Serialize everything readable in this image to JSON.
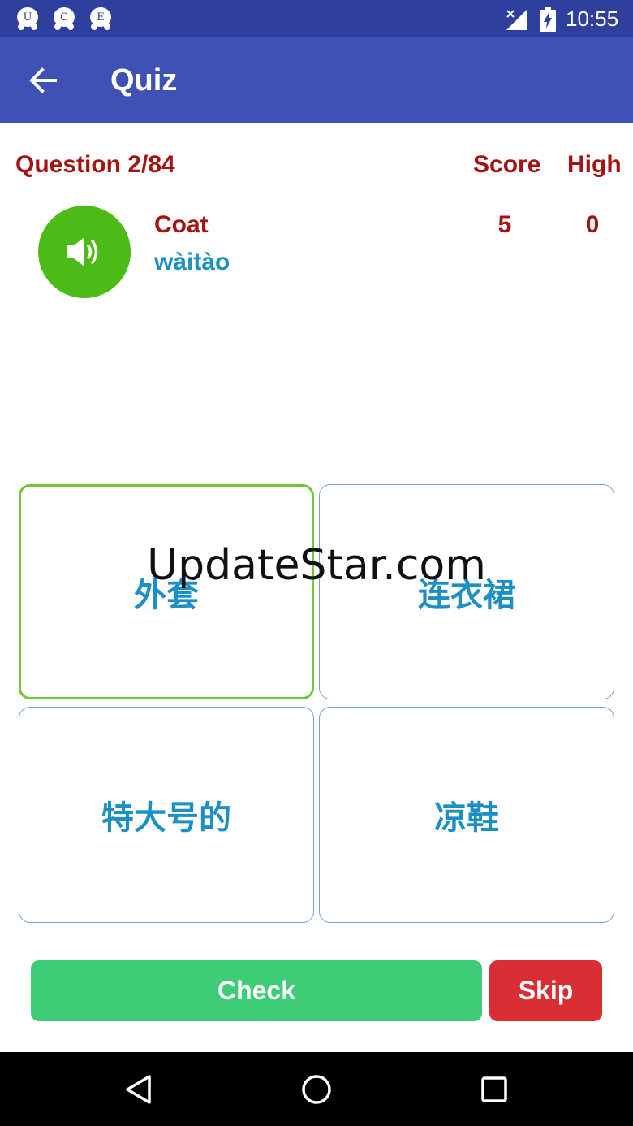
{
  "status_bar": {
    "notifications": [
      "U",
      "C",
      "E"
    ],
    "time": "10:55",
    "icons": [
      "signal-no-data-icon",
      "battery-charging-icon"
    ]
  },
  "app_bar": {
    "title": "Quiz",
    "back_icon": "arrow-left-icon",
    "color": "#3f51b5"
  },
  "quiz": {
    "question_counter": "Question 2/84",
    "score_label": "Score",
    "score_value": "5",
    "high_label": "High",
    "high_value": "0",
    "word": "Coat",
    "pinyin": "wàitào",
    "speaker_icon": "speaker-volume-icon",
    "options": [
      {
        "text": "外套",
        "selected": true
      },
      {
        "text": "连衣裙",
        "selected": false
      },
      {
        "text": "特大号的",
        "selected": false
      },
      {
        "text": "凉鞋",
        "selected": false
      }
    ]
  },
  "actions": {
    "check_label": "Check",
    "skip_label": "Skip"
  },
  "watermark": "UpdateStar.com",
  "nav_bar": {
    "icons": [
      "back-triangle-icon",
      "home-circle-icon",
      "recents-square-icon"
    ]
  },
  "colors": {
    "status_bar": "#2e3f9e",
    "accent_red": "#a31515",
    "accent_blue": "#1e8fc3",
    "speaker_green": "#4cbb17",
    "selected_border": "#76c43a",
    "check_green": "#3ecc76",
    "skip_red": "#d92e34"
  }
}
